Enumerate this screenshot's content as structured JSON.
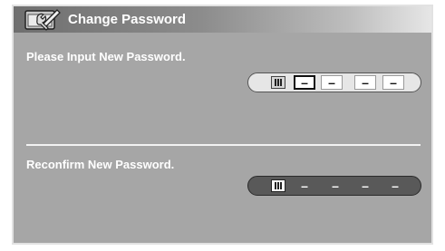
{
  "dialog": {
    "title": "Change Password",
    "icon": "screwdriver-wrench-window-icon"
  },
  "new_password": {
    "prompt": "Please Input New Password.",
    "state": "active",
    "digits": [
      "–",
      "–",
      "–",
      "–"
    ],
    "focused_index": 0,
    "icon": "keypad-icon"
  },
  "reconfirm_password": {
    "prompt": "Reconfirm New Password.",
    "state": "inactive",
    "digits": [
      "–",
      "–",
      "–",
      "–"
    ],
    "icon": "keypad-icon"
  },
  "colors": {
    "panel": "#a6a6a6",
    "header_dark": "#6f6f6f",
    "header_light": "#e6e6e6",
    "active_field": "#e6e6e6",
    "inactive_field": "#595959",
    "text": "#ffffff"
  }
}
